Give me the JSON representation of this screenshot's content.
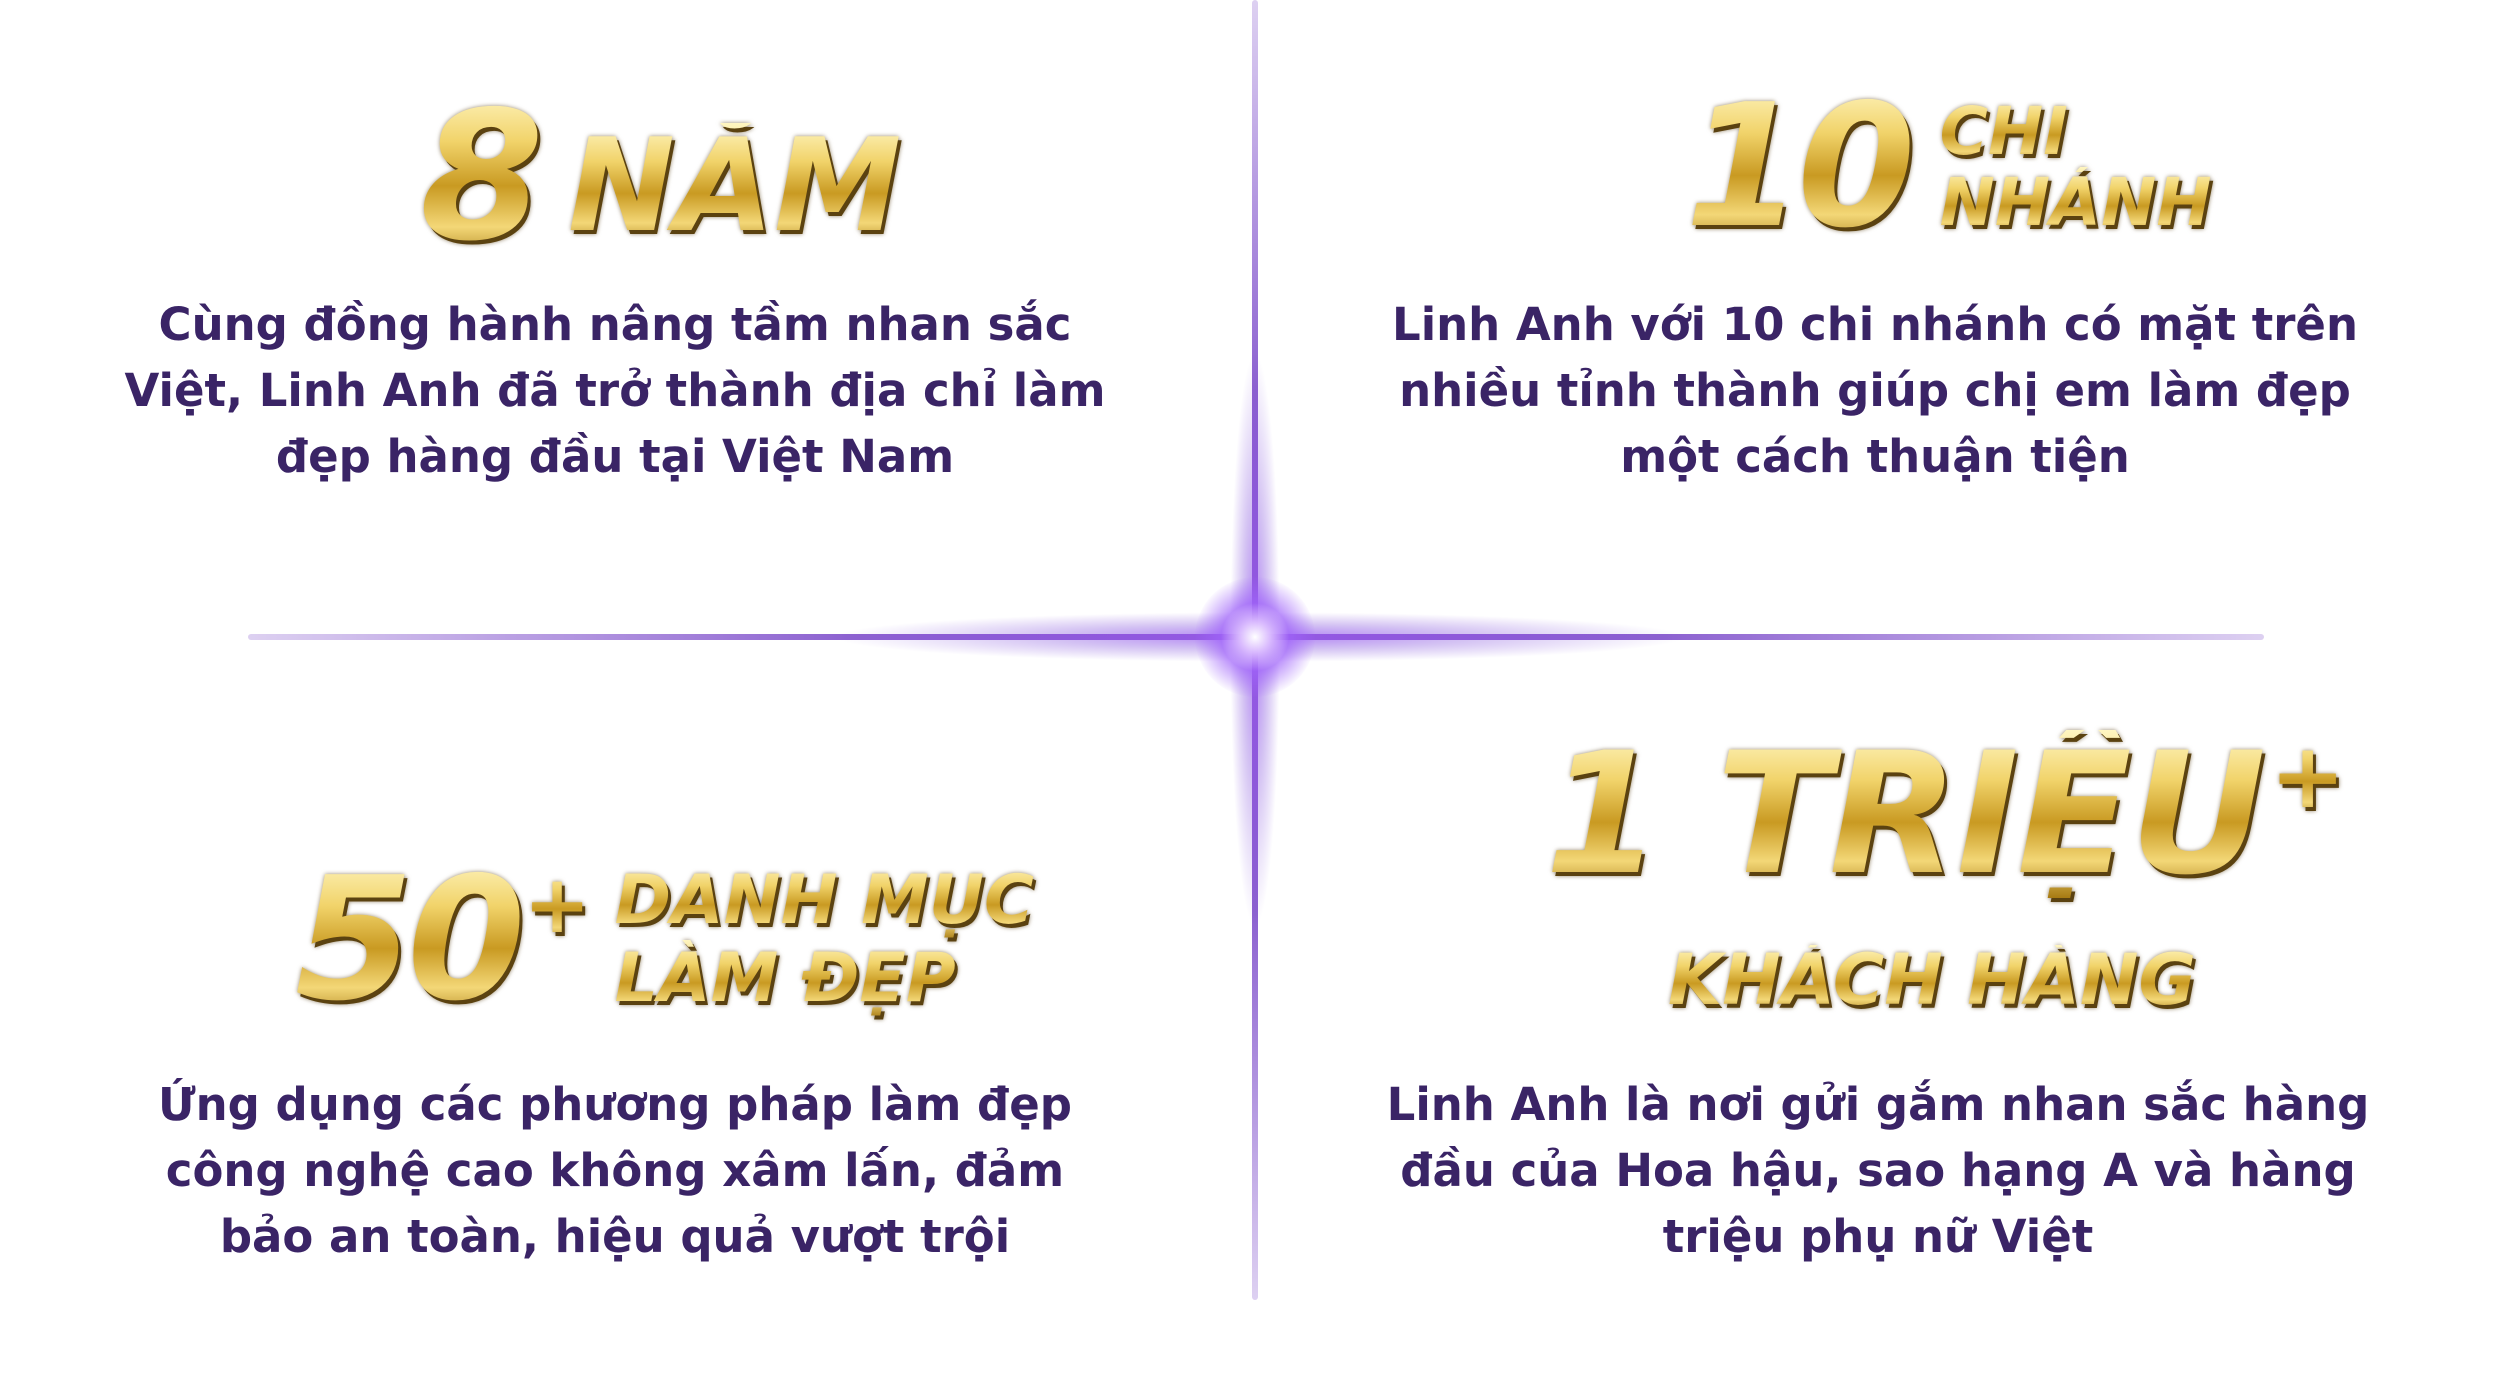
{
  "stats": [
    {
      "value": "8",
      "unit": "NĂM",
      "description": "Cùng đồng hành nâng tầm nhan sắc Việt, Linh Anh đã trở thành địa chỉ làm đẹp hàng đầu tại Việt Nam"
    },
    {
      "value": "10",
      "unit_line_1": "CHI",
      "unit_line_2": "NHÁNH",
      "description": "Linh Anh với 10 chi nhánh có mặt trên nhiều tỉnh thành giúp chị em làm đẹp một cách thuận tiện"
    },
    {
      "value": "50",
      "plus": "+",
      "unit_line_1": "DANH MỤC",
      "unit_line_2": "LÀM ĐẸP",
      "description": "Ứng dụng các phương pháp làm đẹp công nghệ cao không xâm lấn, đảm bảo an toàn, hiệu quả vượt trội"
    },
    {
      "value": "1 TRIỆU",
      "plus": "+",
      "unit": "KHÁCH HÀNG",
      "description": "Linh Anh là nơi gửi gắm nhan sắc hàng đầu của Hoa hậu, sao hạng A và hàng triệu phụ nữ Việt"
    }
  ],
  "colors": {
    "gold": "#d8b23a",
    "text": "#3a2466",
    "divider": "#8a55d8"
  }
}
